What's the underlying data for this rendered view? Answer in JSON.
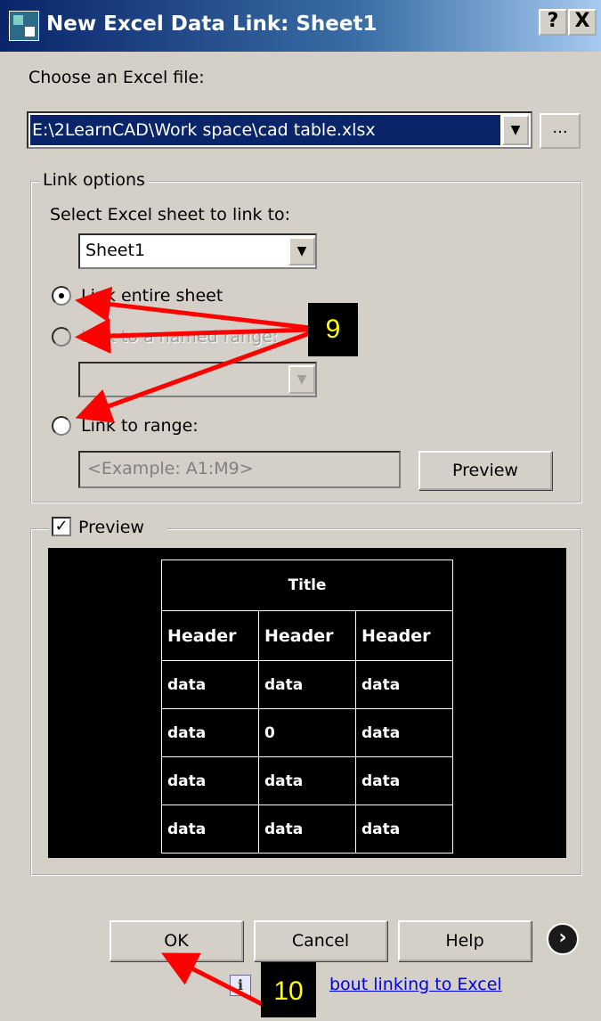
{
  "window": {
    "title": "New Excel Data Link: Sheet1",
    "help_button": "?",
    "close_button": "X"
  },
  "file": {
    "label": "Choose an Excel file:",
    "value": "E:\\2LearnCAD\\Work space\\cad table.xlsx",
    "browse_label": "..."
  },
  "link_options": {
    "legend": "Link options",
    "sheet_label": "Select Excel sheet to link to:",
    "sheet_value": "Sheet1",
    "radio_entire": "Link entire sheet",
    "radio_named": "Link to a named range:",
    "radio_range": "Link to range:",
    "range_placeholder": "<Example: A1:M9>",
    "preview_button": "Preview"
  },
  "preview": {
    "checkbox_label": "Preview",
    "table": {
      "title": "Title",
      "headers": [
        "Header",
        "Header",
        "Header"
      ],
      "rows": [
        [
          "data",
          "data",
          "data"
        ],
        [
          "data",
          "0",
          "data"
        ],
        [
          "data",
          "data",
          "data"
        ],
        [
          "data",
          "data",
          "data"
        ]
      ]
    }
  },
  "buttons": {
    "ok": "OK",
    "cancel": "Cancel",
    "help": "Help",
    "more": "›"
  },
  "learn_link": "bout linking to Excel",
  "callouts": {
    "step9": "9",
    "step10": "10"
  },
  "colors": {
    "dialog_bg": "#d4d0c8",
    "selection": "#0a246a",
    "arrow": "#ff0000",
    "callout_text": "#ffff00"
  }
}
